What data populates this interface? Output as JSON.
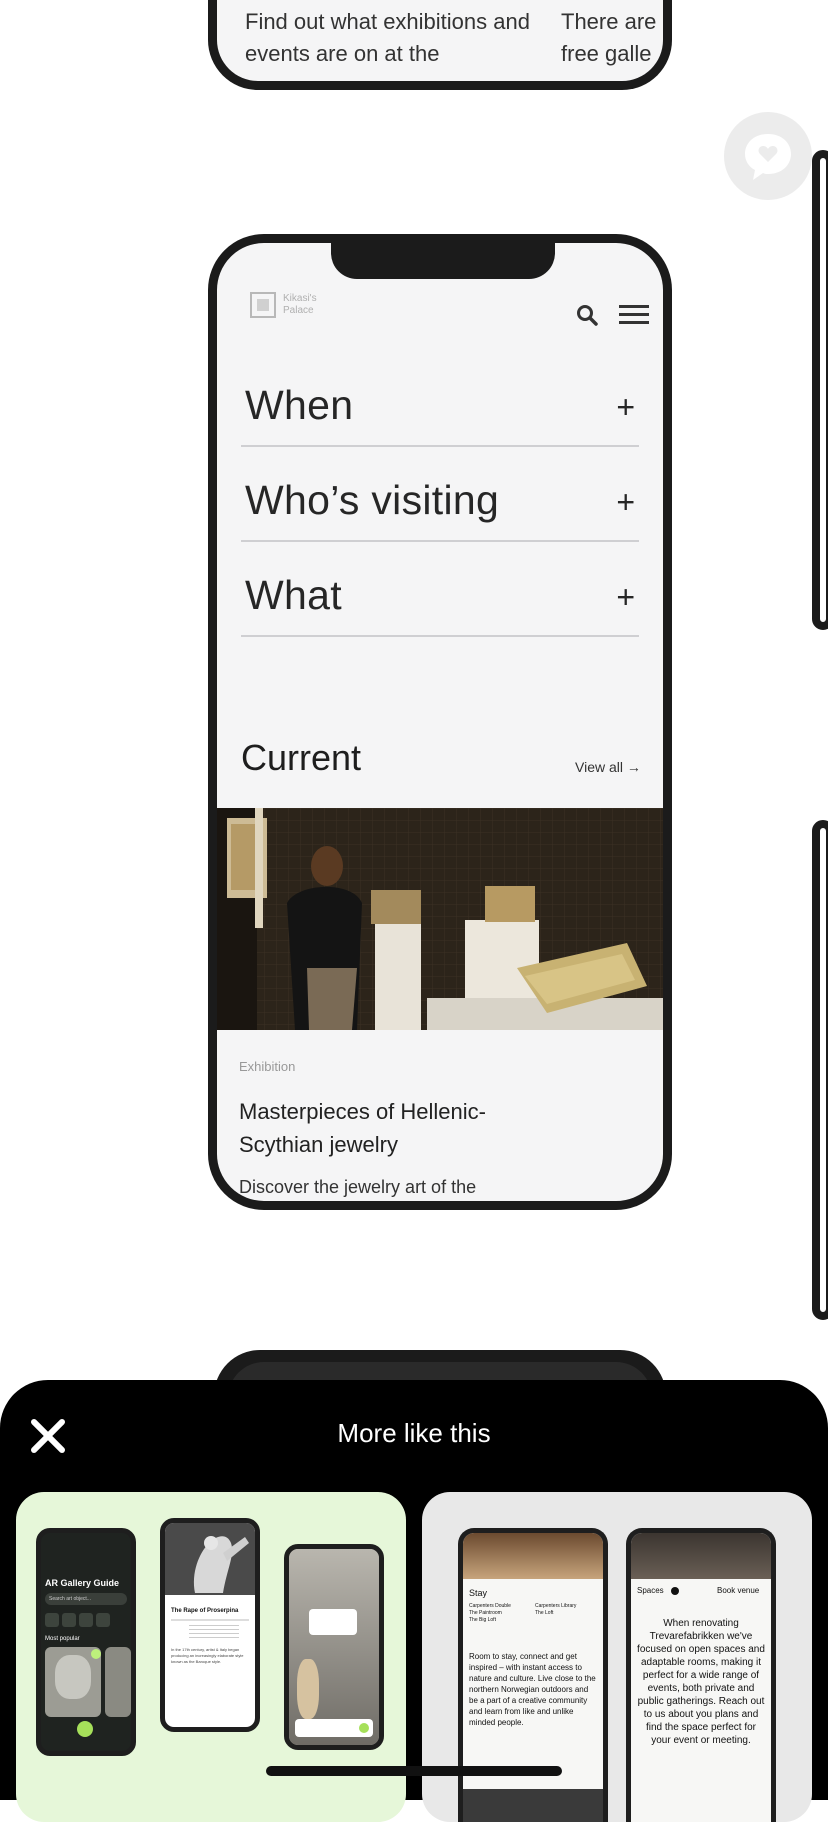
{
  "top_phone": {
    "text_left": "Find out what exhibitions and events are on at the",
    "text_right": "There are free galle"
  },
  "phone": {
    "logo_text": "Kikasi's Palace",
    "accordion": [
      {
        "label": "When",
        "icon": "plus-icon"
      },
      {
        "label": "Who’s visiting",
        "icon": "plus-icon"
      },
      {
        "label": "What",
        "icon": "plus-icon"
      }
    ],
    "current": {
      "title": "Current",
      "view_all": "View all →"
    },
    "exhibition": {
      "tag": "Exhibition",
      "title": "Masterpieces of Hellenic-Scythian jewelry",
      "description": "Discover the jewelry art of the"
    }
  },
  "floating_button": {
    "icon": "chat-heart-icon"
  },
  "sheet": {
    "title": "More like this",
    "close_icon": "close-icon"
  },
  "card1": {
    "app_title": "AR Gallery Guide",
    "search_placeholder": "Search art object...",
    "section": "Most popular",
    "artwork_title": "The Rape of Proserpina",
    "mini_text": "In the 17th century, artist & Italy began producing an increasingly elaborate style known as the Baroque style."
  },
  "card2": {
    "stay_heading": "Stay",
    "rooms_left": "Carpenters Double\nThe Paintroom\nThe Big Loft",
    "rooms_right": "Carpenters Library\nThe Loft",
    "stay_text": "Room to stay, connect and get inspired – with instant access to nature and culture. Live close to the northern Norwegian outdoors and be a part of a creative community and learn from like and unlike minded people.",
    "spaces_label": "Spaces",
    "book_venue": "Book venue",
    "spaces_text": "When renovating Trevarefabrikken we've focused on open spaces and adaptable rooms, making it perfect for a wide range of events, both private and public gatherings. Reach out to us about you plans and find the space perfect for your event or meeting."
  },
  "colors": {
    "sheet_bg": "#000000",
    "card1_bg": "#e6f7d9",
    "card2_bg": "#e8e8e8",
    "phone_frame": "#1b1b1b"
  }
}
